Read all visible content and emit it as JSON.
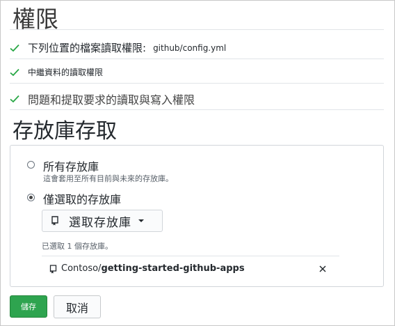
{
  "permissions": {
    "title": "權限",
    "items": [
      {
        "label": "下列位置的檔案讀取權限:",
        "path": "github/config.yml"
      },
      {
        "label": "中繼資料的讀取權限",
        "path": ""
      },
      {
        "label": "問題和提取要求的讀取與寫入權限",
        "path": ""
      }
    ],
    "check_color": "#28a745"
  },
  "repo_access": {
    "title": "存放庫存取",
    "options": [
      {
        "label": "所有存放庫",
        "note": "這會套用至所有目前與未來的存放庫。",
        "checked": false
      },
      {
        "label": "僅選取的存放庫",
        "checked": true
      }
    ],
    "select_button_label": "選取存放庫",
    "selected_count": "已選取 1 個存放庫。",
    "selected_repo": {
      "owner": "Contoso/",
      "name": "getting-started-github-apps"
    }
  },
  "actions": {
    "save_label": "儲存",
    "cancel_label": "取消",
    "save_color": "#2ea44f"
  }
}
